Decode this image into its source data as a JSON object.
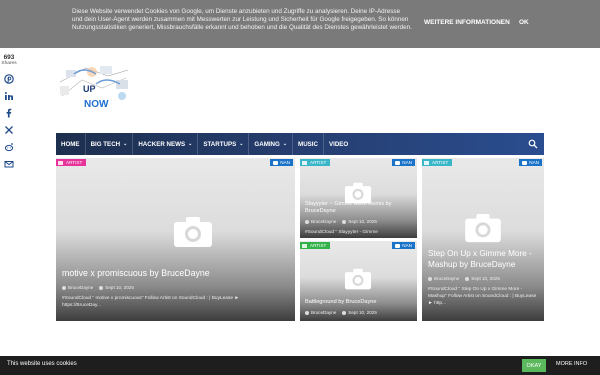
{
  "cookie_top": {
    "text": "Diese Website verwendet Cookies von Google, um Dienste anzubieten und Zugriffe zu analysieren. Deine IP-Adresse und dein User-Agent werden zusammen mit Messwerten zur Leistung und Sicherheit für Google freigegeben. So können Nutzungsstatistiken generiert, Missbrauchsfälle erkannt und behoben und die Qualität des Dienstes gewährleistet werden.",
    "more_label": "WEITERE INFORMATIONEN",
    "ok_label": "OK"
  },
  "share": {
    "count": "693",
    "label": "Shares",
    "buttons": [
      "pinterest-icon",
      "linkedin-icon",
      "facebook-icon",
      "twitter-x-icon",
      "reddit-icon",
      "email-icon"
    ]
  },
  "logo": {
    "alt": "UP NOW"
  },
  "nav": {
    "items": [
      {
        "label": "HOME",
        "dropdown": false
      },
      {
        "label": "BIG TECH",
        "dropdown": true
      },
      {
        "label": "HACKER NEWS",
        "dropdown": true
      },
      {
        "label": "STARTUPS",
        "dropdown": true
      },
      {
        "label": "GAMING",
        "dropdown": true
      },
      {
        "label": "MUSIC",
        "dropdown": false
      },
      {
        "label": "VIDEO",
        "dropdown": false
      }
    ]
  },
  "cards": [
    {
      "category": "ARTIST",
      "badge": "NAN",
      "title": "motive x promiscuous by BruceDayne",
      "author": "BruceDayne",
      "date": "Sept 10, 2025",
      "excerpt": "#SoundCloud \" motive x promiscuous\" Follow Artist on SoundCloud : | BuyLease ► https://BruceDay..."
    },
    {
      "category": "ARTIST",
      "badge": "NAN",
      "title": "Slayyyter ~ Gimme More Remix by BruceDayne",
      "author": "BruceDayne",
      "date": "Sept 10, 2025",
      "excerpt": "#SoundCloud \" Slayyyter - Gimme"
    },
    {
      "category": "ARTIST",
      "badge": "NAN",
      "title": "Battleground by BruceDayne",
      "author": "BruceDayne",
      "date": "Sept 10, 2025",
      "excerpt": ""
    },
    {
      "category": "ARTIST",
      "badge": "NAN",
      "title": "Step On Up x Gimme More - Mashup by BruceDayne",
      "author": "BruceDayne",
      "date": "Sept 10, 2025",
      "excerpt": "#SoundCloud \" Step On Up x Gimme More - Mashup\" Follow Artist on SoundCloud : | BuyLease ► http..."
    }
  ],
  "colors": {
    "cat_pink": "#e6339a",
    "cat_green": "#33b24a",
    "cat_teal": "#3ab6c9",
    "badge_blue": "#1b73c9",
    "nav_dark": "#1d2f4e"
  },
  "cookie_bottom": {
    "text": "This website uses cookies",
    "okay_label": "OKAY",
    "more_label": "MORE INFO"
  }
}
